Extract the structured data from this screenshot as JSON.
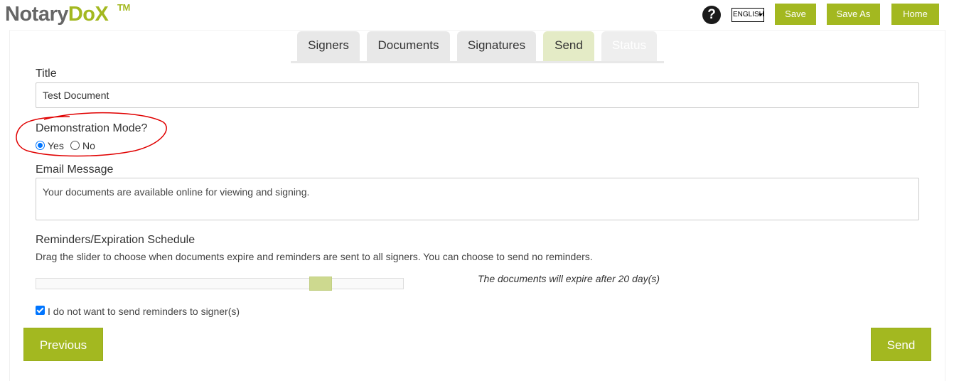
{
  "header": {
    "logo_part1": "Notary",
    "logo_part2": "DoX",
    "logo_tm": "TM",
    "help_glyph": "?",
    "language": "ENGLISH",
    "buttons": {
      "save": "Save",
      "save_as": "Save As",
      "home": "Home"
    }
  },
  "tabs": [
    {
      "label": "Signers",
      "active": false
    },
    {
      "label": "Documents",
      "active": false
    },
    {
      "label": "Signatures",
      "active": false
    },
    {
      "label": "Send",
      "active": true
    },
    {
      "label": "Status",
      "active": false,
      "disabled": true
    }
  ],
  "form": {
    "title_label": "Title",
    "title_value": "Test Document",
    "demo_label": "Demonstration Mode?",
    "demo_options": [
      {
        "label": "Yes",
        "checked": true
      },
      {
        "label": "No",
        "checked": false
      }
    ],
    "email_label": "Email Message",
    "email_value": "Your documents are available online for viewing and signing.",
    "reminders_label": "Reminders/Expiration Schedule",
    "reminders_help": "Drag the slider to choose when documents expire and reminders are sent to all signers. You can choose to send no reminders.",
    "slider_position_fraction": 0.87,
    "expire_text": "The documents will expire after 20 day(s)",
    "no_reminders_label": "I do not want to send reminders to signer(s)",
    "no_reminders_checked": true
  },
  "footer": {
    "previous": "Previous",
    "send": "Send"
  },
  "colors": {
    "accent": "#a3b820",
    "active_tab": "#e4ebc6",
    "slider_handle": "#cdd98f",
    "annotation": "#e00000",
    "radio_checked": "#0075ff"
  }
}
